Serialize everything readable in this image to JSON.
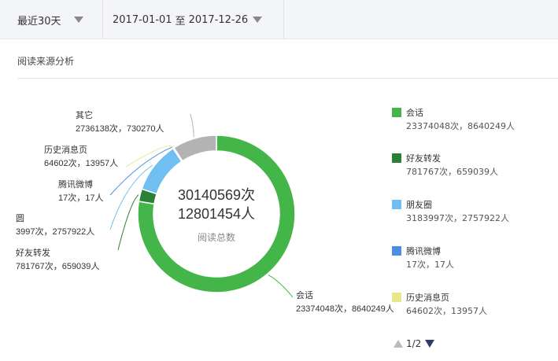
{
  "toolbar": {
    "range_label": "最近30天",
    "date_from": "2017-01-01",
    "date_sep": "至",
    "date_to": "2017-12-26"
  },
  "section": {
    "title": "阅读来源分析"
  },
  "chart_data": {
    "type": "donut",
    "center_total_reads": "30140569次",
    "center_total_users": "12801454人",
    "center_caption": "阅读总数",
    "series": [
      {
        "name": "会话",
        "reads": 23374048,
        "users": 8640249,
        "label": "23374048次，8640249人",
        "color": "#44b549"
      },
      {
        "name": "好友转发",
        "reads": 781767,
        "users": 659039,
        "label": "781767次，659039人",
        "color": "#2a8035"
      },
      {
        "name": "朋友圈",
        "reads": 3183997,
        "users": 2757922,
        "label": "3183997次，2757922人",
        "color": "#6fc0f0"
      },
      {
        "name": "腾讯微博",
        "reads": 17,
        "users": 17,
        "label": "17次，17人",
        "color": "#4a8fe0"
      },
      {
        "name": "历史消息页",
        "reads": 64602,
        "users": 13957,
        "label": "64602次，13957人",
        "color": "#e8e88a"
      },
      {
        "name": "其它",
        "reads": 2736138,
        "users": 730270,
        "label": "2736138次，730270人",
        "color": "#b3b3b3"
      }
    ],
    "callouts": [
      {
        "name": "其它",
        "label": "2736138次，730270人"
      },
      {
        "name": "历史消息页",
        "label": "64602次，13957人"
      },
      {
        "name": "腾讯微博",
        "label": "17次，17人"
      },
      {
        "name": "圆",
        "label": "3997次，2757922人"
      },
      {
        "name": "好友转发",
        "label": "781767次，659039人"
      },
      {
        "name": "会话",
        "label": "23374048次，8640249人"
      }
    ]
  },
  "pager": {
    "text": "1/2"
  }
}
